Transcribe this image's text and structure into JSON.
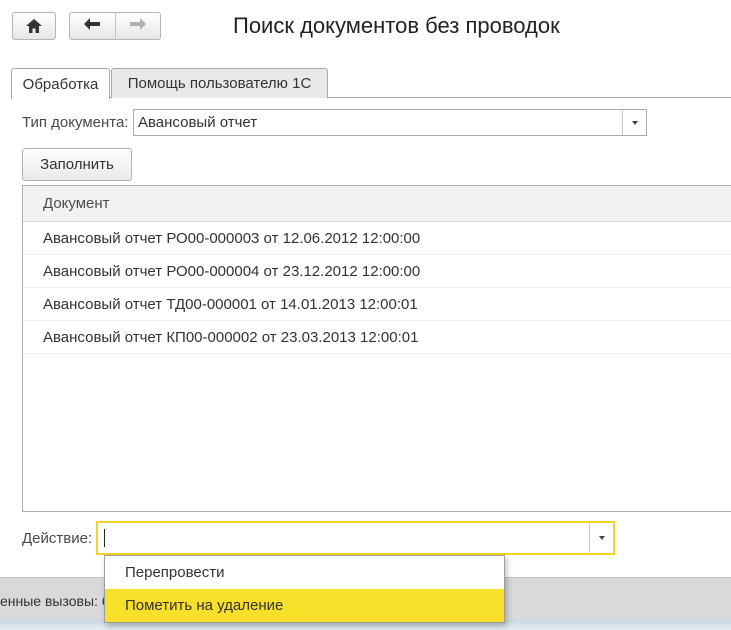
{
  "header": {
    "title": "Поиск документов без проводок"
  },
  "tabs": [
    {
      "label": "Обработка",
      "active": true
    },
    {
      "label": "Помощь пользователю 1С",
      "active": false
    }
  ],
  "form": {
    "doc_type_label": "Тип документа:",
    "doc_type_value": "Авансовый отчет",
    "fill_button": "Заполнить",
    "action_label": "Действие:",
    "action_value": ""
  },
  "table": {
    "columns": [
      "Документ"
    ],
    "rows": [
      "Авансовый отчет РО00-000003 от 12.06.2012 12:00:00",
      "Авансовый отчет РО00-000004 от 23.12.2012 12:00:00",
      "Авансовый отчет ТД00-000001 от 14.01.2013 12:00:01",
      "Авансовый отчет КП00-000002 от 23.03.2013 12:00:01"
    ]
  },
  "dropdown": {
    "options": [
      "Перепровести",
      "Пометить на удаление"
    ],
    "highlighted_index": 1
  },
  "statusbar": {
    "text": "енные вызовы: 6"
  },
  "icons": {
    "home": "home-icon",
    "back": "arrow-left-icon",
    "forward": "arrow-right-icon",
    "dropdown": "chevron-down-icon"
  },
  "colors": {
    "accent": "#f7df2a",
    "focus_border": "#f2d22e"
  }
}
